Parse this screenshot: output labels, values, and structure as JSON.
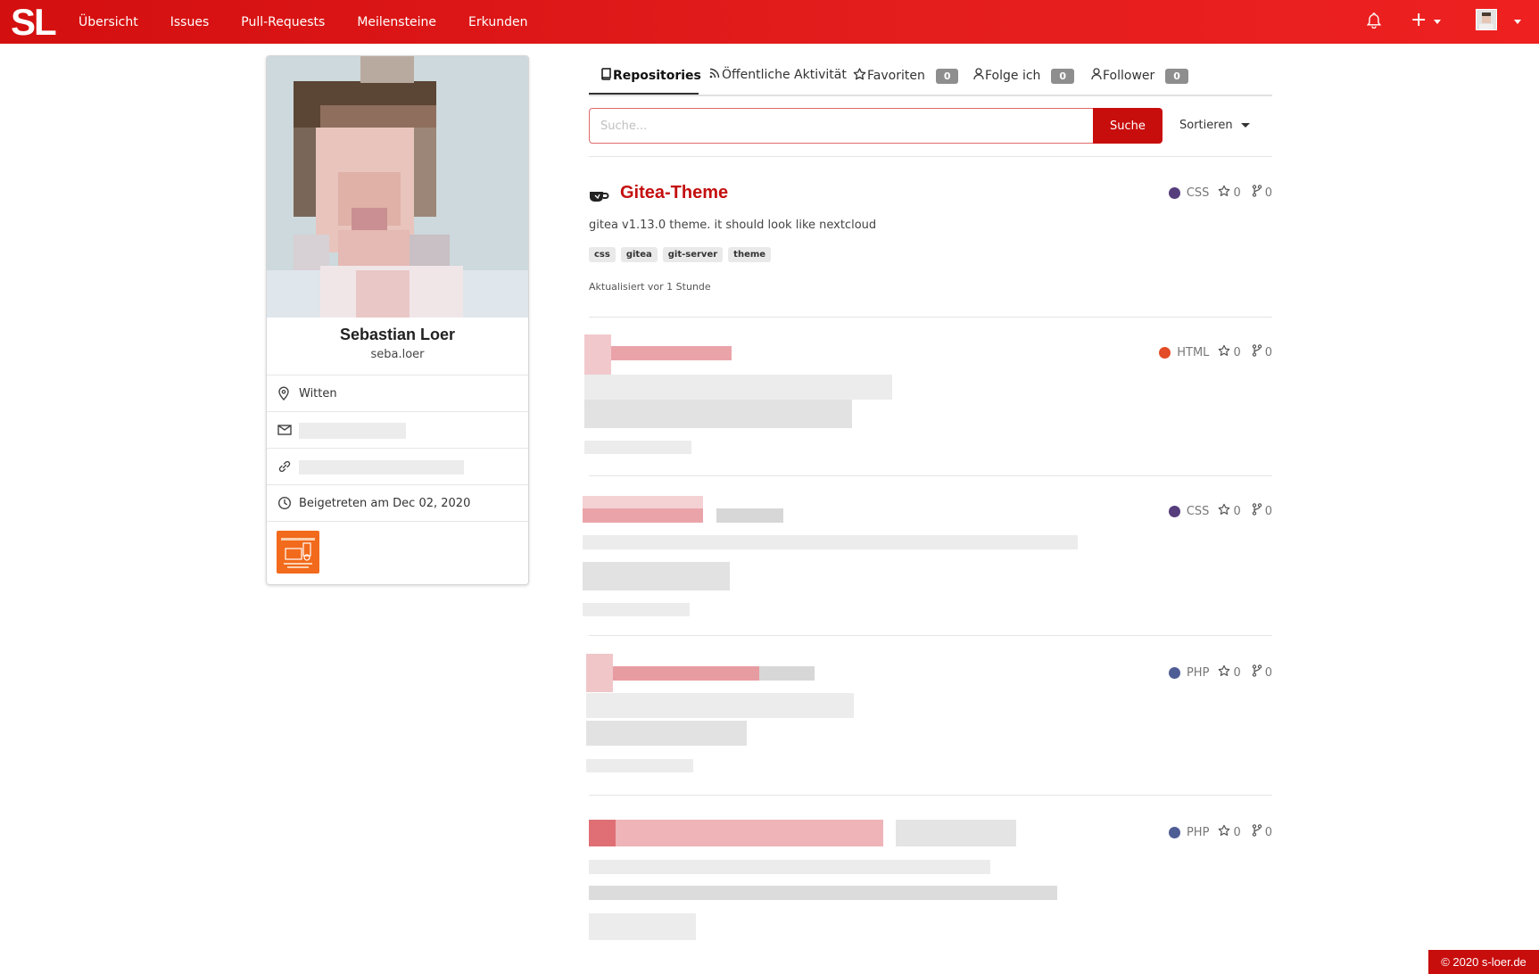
{
  "nav": {
    "logo": "SL",
    "items": [
      "Übersicht",
      "Issues",
      "Pull-Requests",
      "Meilensteine",
      "Erkunden"
    ]
  },
  "profile": {
    "full_name": "Sebastian Loer",
    "username": "seba.loer",
    "location": "Witten",
    "joined": "Beigetreten am Dec 02, 2020"
  },
  "tabs": {
    "repositories": "Repositories",
    "activity": "Öffentliche Aktivität",
    "stars": "Favoriten",
    "stars_count": "0",
    "following": "Folge ich",
    "following_count": "0",
    "followers": "Follower",
    "followers_count": "0"
  },
  "search": {
    "placeholder": "Suche...",
    "button": "Suche",
    "sort": "Sortieren"
  },
  "repos": [
    {
      "name": "Gitea-Theme",
      "description": "gitea v1.13.0 theme. it should look like nextcloud",
      "topics": [
        "css",
        "gitea",
        "git-server",
        "theme"
      ],
      "updated": "Aktualisiert vor 1 Stunde",
      "language": "CSS",
      "lang_color": "#563d7c",
      "stars": "0",
      "forks": "0"
    },
    {
      "language": "HTML",
      "lang_color": "#e34c26",
      "stars": "0",
      "forks": "0"
    },
    {
      "language": "CSS",
      "lang_color": "#563d7c",
      "stars": "0",
      "forks": "0"
    },
    {
      "language": "PHP",
      "lang_color": "#4f5d95",
      "stars": "0",
      "forks": "0"
    },
    {
      "language": "PHP",
      "lang_color": "#4f5d95",
      "stars": "0",
      "forks": "0"
    }
  ],
  "footer": "© 2020 s-loer.de"
}
